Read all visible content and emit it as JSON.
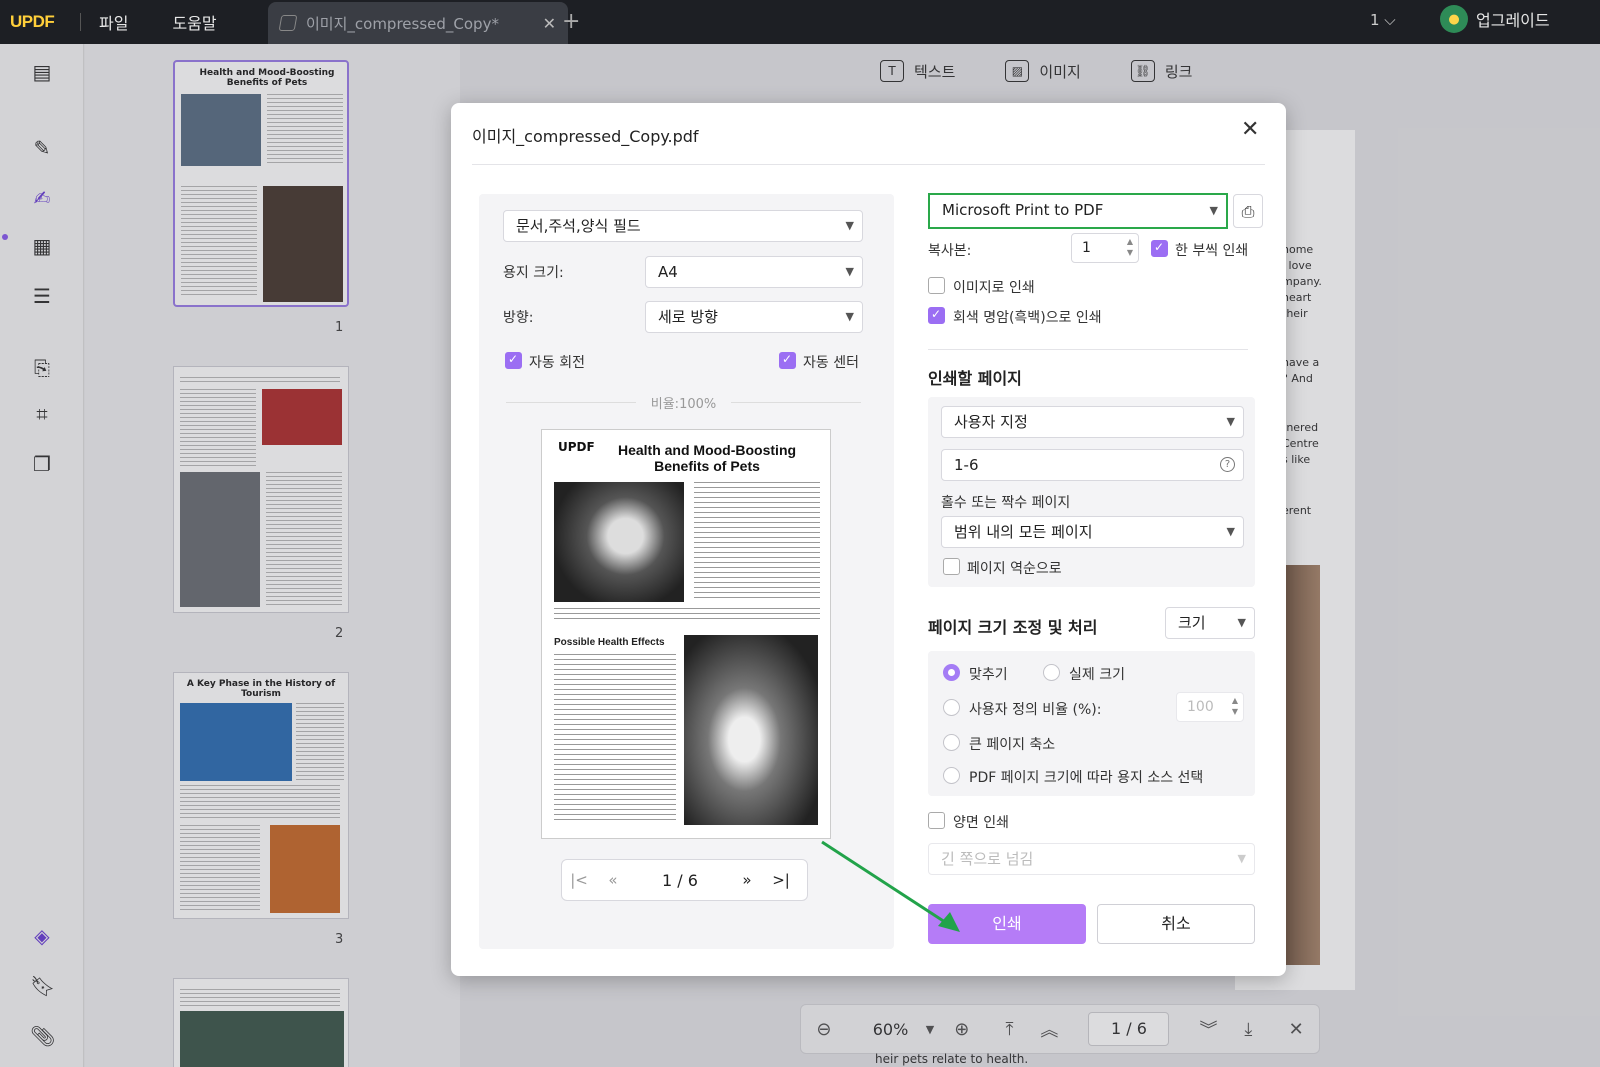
{
  "topbar": {
    "logo": "UPDF",
    "menu": [
      "파일",
      "도움말"
    ],
    "tab_title": "이미지_compressed_Copy*",
    "tab_close": "✕",
    "new_tab": "+",
    "page_selector": "1 ⌵",
    "upgrade": "업그레이드"
  },
  "thumbnails": [
    {
      "page": "1",
      "title": "Health and Mood-Boosting Benefits of Pets"
    },
    {
      "page": "2",
      "title": ""
    },
    {
      "page": "3",
      "title": "A Key Phase in the History of Tourism"
    }
  ],
  "edit_toolbar": {
    "text": "텍스트",
    "image": "이미지",
    "link": "링크"
  },
  "background_text": [
    "home",
    "l love",
    "mpany.",
    "heart",
    "their",
    "have a",
    "? And",
    "tnered",
    "Centre",
    "s like",
    "erent"
  ],
  "zoom": {
    "value": "60%",
    "page": "1 / 6"
  },
  "bottom_text": "heir pets relate to health.",
  "dialog": {
    "title": "이미지_compressed_Copy.pdf",
    "content_select": "문서,주석,양식 필드",
    "paper_size_label": "용지 크기:",
    "paper_size": "A4",
    "orientation_label": "방향:",
    "orientation": "세로 방향",
    "auto_rotate": "자동 회전",
    "auto_center": "자동 센터",
    "ratio": "비율:100%",
    "preview": {
      "logo": "UPDF",
      "title": "Health and Mood-Boosting Benefits of Pets",
      "subtitle": "Possible Health Effects"
    },
    "pager": {
      "current": "1",
      "sep": "/",
      "total": "6"
    },
    "printer": "Microsoft Print to PDF",
    "copies_label": "복사본:",
    "copies": "1",
    "collate": "한 부씩 인쇄",
    "print_as_image": "이미지로 인쇄",
    "grayscale": "회색 명암(흑백)으로 인쇄",
    "pages_section": "인쇄할 페이지",
    "pages_mode": "사용자 지정",
    "pages_range": "1-6",
    "odd_even_label": "홀수 또는 짝수 페이지",
    "odd_even": "범위 내의 모든 페이지",
    "reverse": "페이지 역순으로",
    "sizing_section": "페이지 크기 조정 및 처리",
    "sizing_mode": "크기",
    "fit": "맞추기",
    "actual_size": "실제 크기",
    "custom_scale": "사용자 정의 비율 (%):",
    "custom_scale_value": "100",
    "shrink_large": "큰 페이지 축소",
    "choose_source": "PDF 페이지 크기에 따라 용지 소스 선택",
    "duplex": "양면 인쇄",
    "flip": "긴 쪽으로 넘김",
    "print_button": "인쇄",
    "cancel_button": "취소"
  },
  "colors": {
    "accent": "#b57cf7",
    "highlight_border": "#2aa84a",
    "arrow": "#22a34a"
  }
}
